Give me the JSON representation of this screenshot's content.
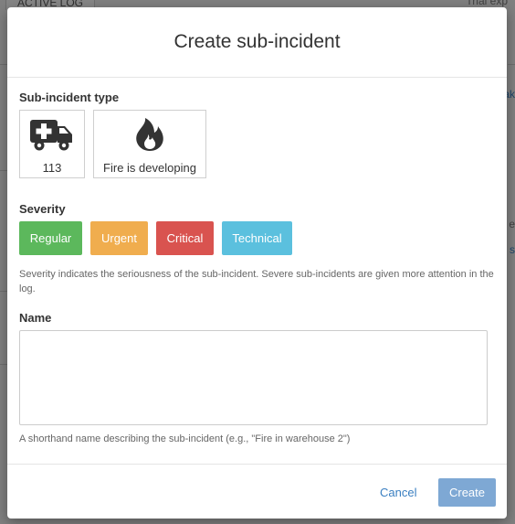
{
  "background": {
    "tab_label": "ACTIVE LOG",
    "top_right_text": "Trial exp",
    "right_link_fragment": "ak",
    "right_fragment_2": "e",
    "right_fragment_3": "s"
  },
  "modal": {
    "title": "Create sub-incident",
    "type_section": {
      "label": "Sub-incident type",
      "options": [
        {
          "label": "113",
          "icon": "ambulance-icon"
        },
        {
          "label": "Fire is developing",
          "icon": "fire-icon"
        }
      ]
    },
    "severity_section": {
      "label": "Severity",
      "options": [
        {
          "label": "Regular",
          "color": "#5cb85c"
        },
        {
          "label": "Urgent",
          "color": "#f0ad4e"
        },
        {
          "label": "Critical",
          "color": "#d9534f"
        },
        {
          "label": "Technical",
          "color": "#5bc0de"
        }
      ],
      "help": "Severity indicates the seriousness of the sub-incident. Severe sub-incidents are given more attention in the log."
    },
    "name_section": {
      "label": "Name",
      "value": "",
      "help": "A shorthand name describing the sub-incident (e.g., \"Fire in warehouse 2\")"
    },
    "footer": {
      "cancel_label": "Cancel",
      "create_label": "Create",
      "create_color": "#7ea8d4"
    }
  }
}
